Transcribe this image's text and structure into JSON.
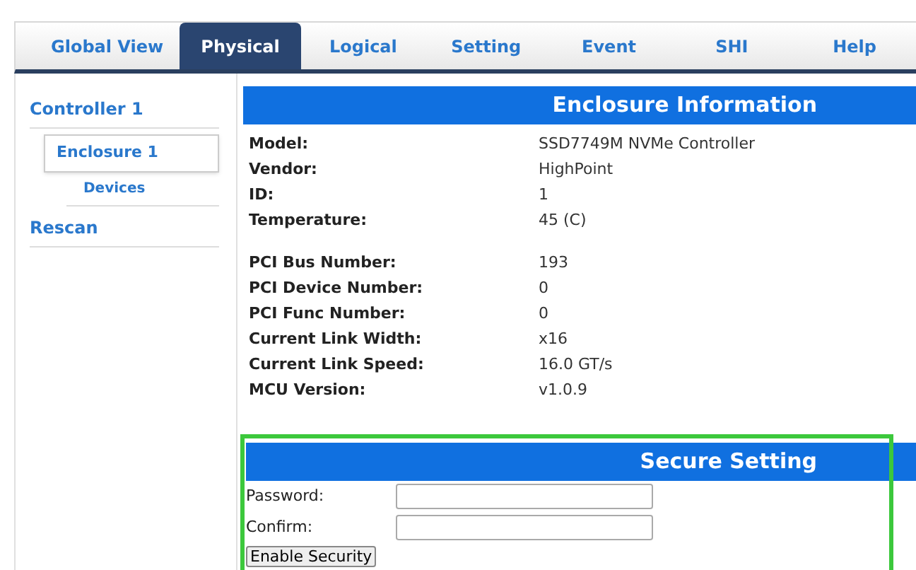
{
  "tabs": [
    {
      "label": "Global View",
      "selected": false
    },
    {
      "label": "Physical",
      "selected": true
    },
    {
      "label": "Logical",
      "selected": false
    },
    {
      "label": "Setting",
      "selected": false
    },
    {
      "label": "Event",
      "selected": false
    },
    {
      "label": "SHI",
      "selected": false
    },
    {
      "label": "Help",
      "selected": false
    }
  ],
  "sidebar": {
    "items": [
      {
        "label": "Controller 1",
        "selected": false,
        "children": [
          {
            "label": "Enclosure 1",
            "selected": true,
            "children": [
              {
                "label": "Devices",
                "selected": false
              }
            ]
          }
        ]
      },
      {
        "label": "Rescan",
        "selected": false
      }
    ]
  },
  "enclosure_information": {
    "title": "Enclosure Information",
    "groups": [
      [
        {
          "label": "Model:",
          "value": "SSD7749M NVMe Controller"
        },
        {
          "label": "Vendor:",
          "value": "HighPoint"
        },
        {
          "label": "ID:",
          "value": "1"
        },
        {
          "label": "Temperature:",
          "value": "45 (C)"
        }
      ],
      [
        {
          "label": "PCI Bus Number:",
          "value": "193"
        },
        {
          "label": "PCI Device Number:",
          "value": "0"
        },
        {
          "label": "PCI Func Number:",
          "value": "0"
        },
        {
          "label": "Current Link Width:",
          "value": "x16"
        },
        {
          "label": "Current Link Speed:",
          "value": "16.0 GT/s"
        },
        {
          "label": "MCU Version:",
          "value": "v1.0.9"
        }
      ]
    ]
  },
  "secure_setting": {
    "title": "Secure Setting",
    "highlighted": true,
    "fields": [
      {
        "label": "Password:"
      },
      {
        "label": "Confirm:"
      }
    ],
    "button": "Enable Security"
  }
}
